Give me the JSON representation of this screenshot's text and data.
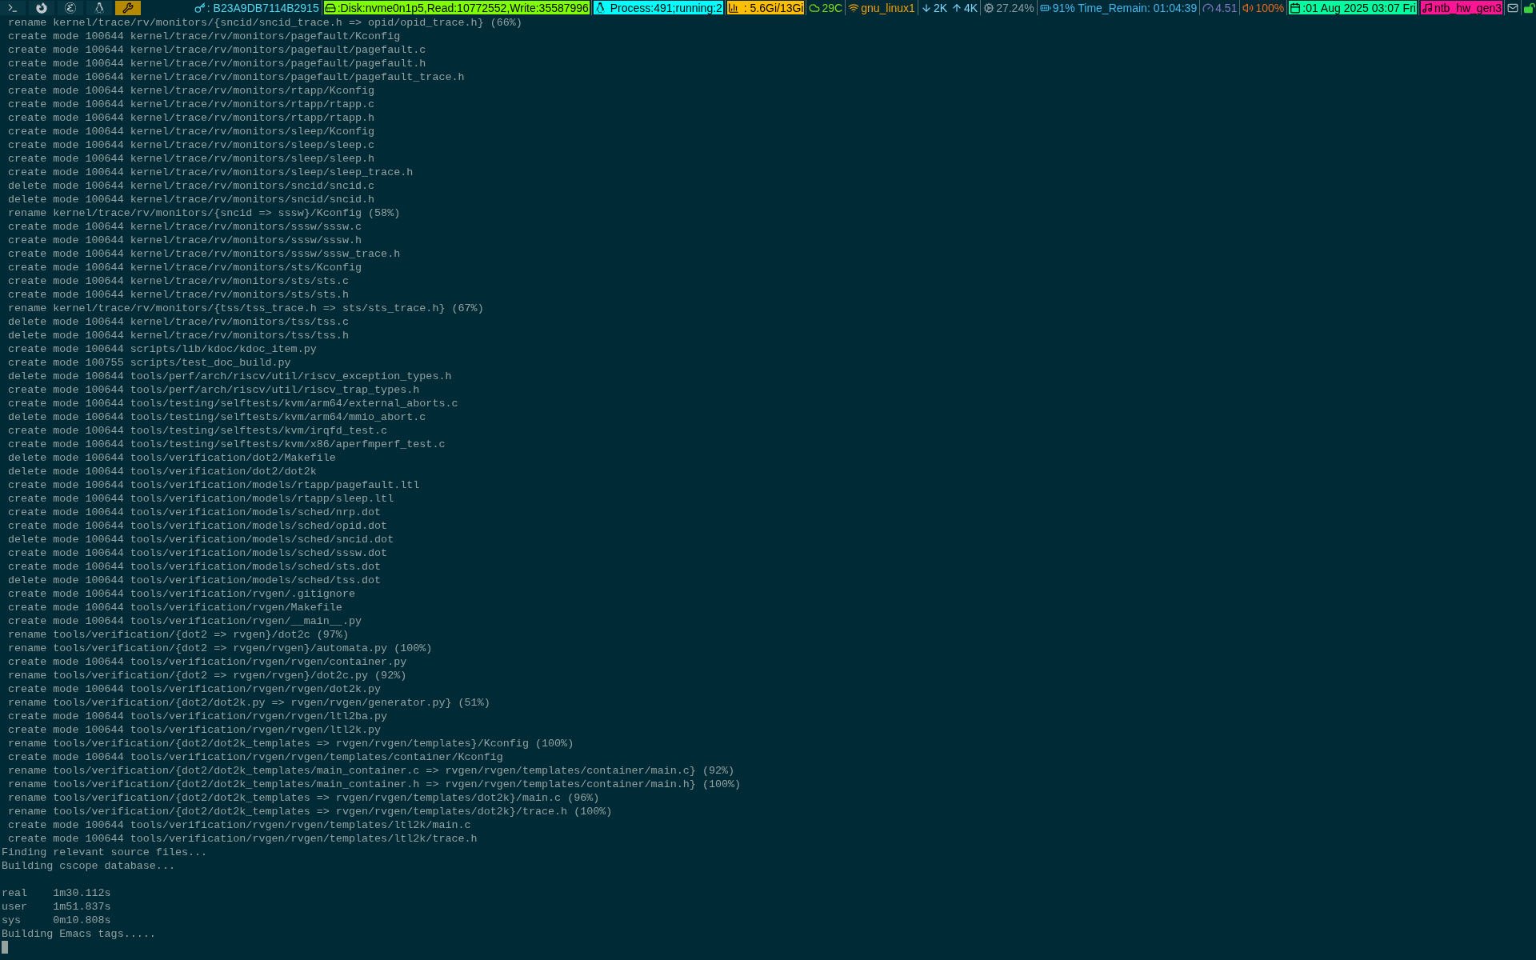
{
  "workspaces": [
    {
      "kind": "terminal",
      "selected": false
    },
    {
      "kind": "firefox",
      "selected": false
    },
    {
      "kind": "emacs",
      "selected": false
    },
    {
      "kind": "linux",
      "selected": false
    },
    {
      "kind": "tools",
      "selected": true
    }
  ],
  "status": [
    {
      "kind": "key",
      "text": ": B23A9DB7114B2915",
      "color": "#4fd8f0",
      "filled": false
    },
    {
      "kind": "disk",
      "text": ":Disk:nvme0n1p5,Read:10772552,Write:35587996",
      "color": "#7fff00",
      "filled": true
    },
    {
      "kind": "linux",
      "text": " Process:491;running:2",
      "color": "#00ffff",
      "filled": true
    },
    {
      "kind": "chart",
      "text": " : 5.6Gi/13Gi",
      "color": "#ffbf00",
      "filled": true
    },
    {
      "kind": "cloud",
      "text": "29C",
      "color": "#7fdb1a"
    },
    {
      "kind": "wifi",
      "text": "gnu_linux1",
      "color": "#f0a000"
    },
    {
      "kind": "down",
      "text": "2K",
      "color": "#7fd8ff"
    },
    {
      "kind": "up",
      "text": "4K",
      "color": "#7fd8ff"
    },
    {
      "kind": "gear",
      "text": "27.24%",
      "color": "#8a9aa0"
    },
    {
      "kind": "battery",
      "text": "91% Time_Remain: 01:04:39",
      "color": "#3fb8f0"
    },
    {
      "kind": "gauge",
      "text": "4.51",
      "color": "#8878c8"
    },
    {
      "kind": "speaker",
      "text": "100%",
      "color": "#e86a1a"
    },
    {
      "kind": "calendar",
      "text": ":01 Aug 2025 03:07 Fri",
      "color": "#00ff9f",
      "filled": true
    },
    {
      "kind": "music",
      "text": "ntb_hw_gen3",
      "color": "#ff1493",
      "filled": true
    },
    {
      "kind": "mail",
      "color": "#b0b8bc"
    },
    {
      "kind": "lock",
      "color": "#3fd03f"
    }
  ],
  "terminal": {
    "blocks": [
      [
        " rename kernel/trace/rv/monitors/{sncid/sncid_trace.h => opid/opid_trace.h} (66%)",
        " create mode 100644 kernel/trace/rv/monitors/pagefault/Kconfig",
        " create mode 100644 kernel/trace/rv/monitors/pagefault/pagefault.c",
        " create mode 100644 kernel/trace/rv/monitors/pagefault/pagefault.h",
        " create mode 100644 kernel/trace/rv/monitors/pagefault/pagefault_trace.h",
        " create mode 100644 kernel/trace/rv/monitors/rtapp/Kconfig",
        " create mode 100644 kernel/trace/rv/monitors/rtapp/rtapp.c",
        " create mode 100644 kernel/trace/rv/monitors/rtapp/rtapp.h",
        " create mode 100644 kernel/trace/rv/monitors/sleep/Kconfig",
        " create mode 100644 kernel/trace/rv/monitors/sleep/sleep.c",
        " create mode 100644 kernel/trace/rv/monitors/sleep/sleep.h",
        " create mode 100644 kernel/trace/rv/monitors/sleep/sleep_trace.h",
        " delete mode 100644 kernel/trace/rv/monitors/sncid/sncid.c",
        " delete mode 100644 kernel/trace/rv/monitors/sncid/sncid.h",
        " rename kernel/trace/rv/monitors/{sncid => sssw}/Kconfig (58%)",
        " create mode 100644 kernel/trace/rv/monitors/sssw/sssw.c",
        " create mode 100644 kernel/trace/rv/monitors/sssw/sssw.h",
        " create mode 100644 kernel/trace/rv/monitors/sssw/sssw_trace.h",
        " create mode 100644 kernel/trace/rv/monitors/sts/Kconfig",
        " create mode 100644 kernel/trace/rv/monitors/sts/sts.c",
        " create mode 100644 kernel/trace/rv/monitors/sts/sts.h",
        " rename kernel/trace/rv/monitors/{tss/tss_trace.h => sts/sts_trace.h} (67%)",
        " delete mode 100644 kernel/trace/rv/monitors/tss/tss.c",
        " delete mode 100644 kernel/trace/rv/monitors/tss/tss.h",
        " create mode 100644 scripts/lib/kdoc/kdoc_item.py",
        " create mode 100755 scripts/test_doc_build.py",
        " delete mode 100644 tools/perf/arch/riscv/util/riscv_exception_types.h",
        " create mode 100644 tools/perf/arch/riscv/util/riscv_trap_types.h",
        " create mode 100644 tools/testing/selftests/kvm/arm64/external_aborts.c",
        " delete mode 100644 tools/testing/selftests/kvm/arm64/mmio_abort.c",
        " create mode 100644 tools/testing/selftests/kvm/irqfd_test.c",
        " create mode 100644 tools/testing/selftests/kvm/x86/aperfmperf_test.c",
        " delete mode 100644 tools/verification/dot2/Makefile",
        " delete mode 100644 tools/verification/dot2/dot2k",
        " create mode 100644 tools/verification/models/rtapp/pagefault.ltl",
        " create mode 100644 tools/verification/models/rtapp/sleep.ltl",
        " create mode 100644 tools/verification/models/sched/nrp.dot",
        " create mode 100644 tools/verification/models/sched/opid.dot",
        " delete mode 100644 tools/verification/models/sched/sncid.dot",
        " create mode 100644 tools/verification/models/sched/sssw.dot",
        " create mode 100644 tools/verification/models/sched/sts.dot",
        " delete mode 100644 tools/verification/models/sched/tss.dot",
        " create mode 100644 tools/verification/rvgen/.gitignore",
        " create mode 100644 tools/verification/rvgen/Makefile",
        " create mode 100644 tools/verification/rvgen/__main__.py",
        " rename tools/verification/{dot2 => rvgen}/dot2c (97%)",
        " rename tools/verification/{dot2 => rvgen/rvgen}/automata.py (100%)",
        " create mode 100644 tools/verification/rvgen/rvgen/container.py",
        " rename tools/verification/{dot2 => rvgen/rvgen}/dot2c.py (92%)",
        " create mode 100644 tools/verification/rvgen/rvgen/dot2k.py",
        " rename tools/verification/{dot2/dot2k.py => rvgen/rvgen/generator.py} (51%)",
        " create mode 100644 tools/verification/rvgen/rvgen/ltl2ba.py",
        " create mode 100644 tools/verification/rvgen/rvgen/ltl2k.py",
        " rename tools/verification/{dot2/dot2k_templates => rvgen/rvgen/templates}/Kconfig (100%)",
        " create mode 100644 tools/verification/rvgen/rvgen/templates/container/Kconfig",
        " rename tools/verification/{dot2/dot2k_templates/main_container.c => rvgen/rvgen/templates/container/main.c} (92%)",
        " rename tools/verification/{dot2/dot2k_templates/main_container.h => rvgen/rvgen/templates/container/main.h} (100%)",
        " rename tools/verification/{dot2/dot2k_templates => rvgen/rvgen/templates/dot2k}/main.c (96%)",
        " rename tools/verification/{dot2/dot2k_templates => rvgen/rvgen/templates/dot2k}/trace.h (100%)",
        " create mode 100644 tools/verification/rvgen/rvgen/templates/ltl2k/main.c",
        " create mode 100644 tools/verification/rvgen/rvgen/templates/ltl2k/trace.h",
        "Finding relevant source files...",
        "Building cscope database..."
      ],
      [
        "real    1m30.112s",
        "user    1m51.837s",
        "sys     0m10.808s",
        "Building Emacs tags....."
      ]
    ]
  }
}
